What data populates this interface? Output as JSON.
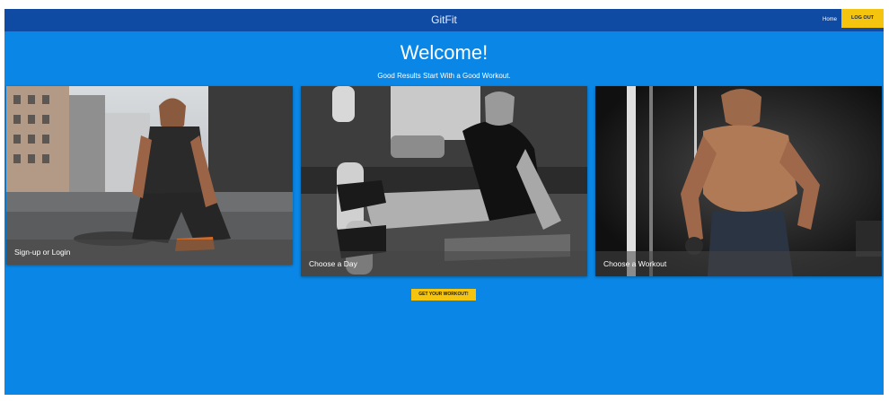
{
  "navbar": {
    "brand": "GitFit",
    "home": "Home",
    "logout": "LOG OUT"
  },
  "hero": {
    "title": "Welcome!",
    "tagline": "Good Results Start With a Good Workout."
  },
  "cards": [
    {
      "caption": "Sign-up or Login"
    },
    {
      "caption": "Choose a Day"
    },
    {
      "caption": "Choose a Workout"
    }
  ],
  "cta": {
    "label": "GET YOUR WORKOUT!"
  }
}
